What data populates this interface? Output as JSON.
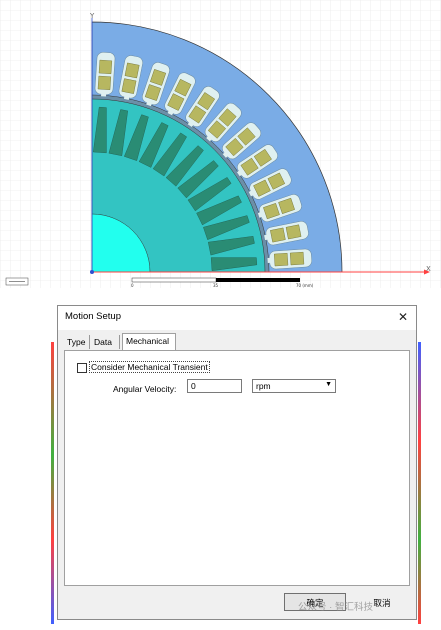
{
  "viewport": {
    "axis_y_label": "Y",
    "axis_x_label": "X",
    "scale_bar": {
      "label_start": "0",
      "label_mid": "35",
      "label_end": "70 (mm)"
    }
  },
  "dialog": {
    "title": "Motion Setup",
    "close_symbol": "✕",
    "tabs": [
      {
        "label": "Type",
        "active": false
      },
      {
        "label": "Data",
        "active": false
      },
      {
        "label": "Mechanical",
        "active": true
      }
    ],
    "consider_transient": {
      "label": "Consider Mechanical Transient",
      "checked": false
    },
    "angular_velocity": {
      "label": "Angular Velocity:",
      "value": "0",
      "unit": "rpm",
      "arrow_symbol": "▼"
    },
    "ok_label": "确定",
    "cancel_label": "取消"
  },
  "watermark": "公众号 · 智汇科技",
  "colors": {
    "stator": "#7aace6",
    "rotor": "#33c4c2",
    "shaft": "#22ffee",
    "slot": "#dff0f0",
    "coil": "#b7b760",
    "rotor_slot": "#2a8c74",
    "axis": "#ff4040",
    "grid": "#e3e3e3"
  }
}
